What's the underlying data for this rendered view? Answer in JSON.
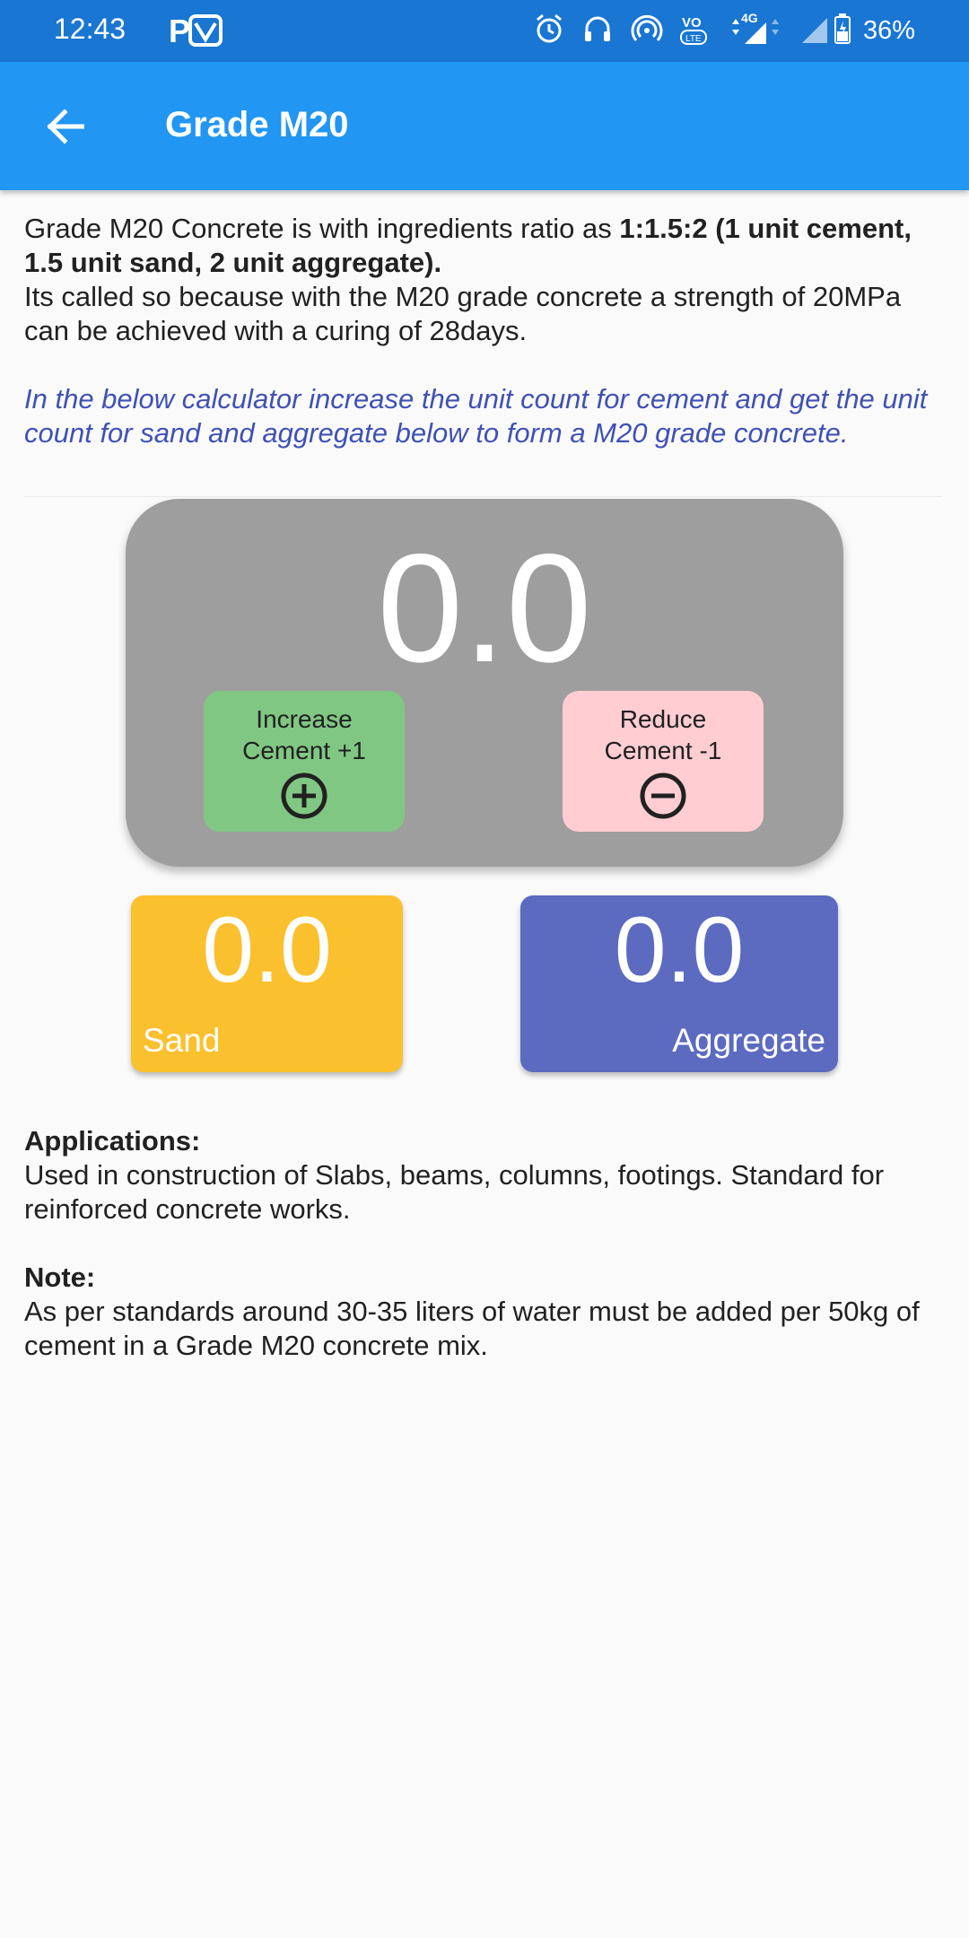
{
  "status_bar": {
    "time": "12:43",
    "network": "4G",
    "volte": "VO LTE",
    "battery": "36%"
  },
  "header": {
    "title": "Grade M20"
  },
  "intro": {
    "text_prefix": "Grade M20 Concrete is with ingredients ratio as ",
    "ratio_bold": "1:1.5:2 (1 unit cement, 1.5 unit sand, 2 unit aggregate).",
    "text_second": "Its called so because with the M20 grade concrete a strength of 20MPa can be achieved with a curing of 28days."
  },
  "calculator_hint": "In the below calculator increase the unit count for cement and get the unit count for sand and aggregate below to form a M20 grade concrete.",
  "calculator": {
    "cement_value": "0.0",
    "increase_label": "Increase Cement +1",
    "reduce_label": "Reduce Cement -1",
    "sand_value": "0.0",
    "sand_label": "Sand",
    "aggregate_value": "0.0",
    "aggregate_label": "Aggregate"
  },
  "applications": {
    "heading": "Applications:",
    "text": "Used in construction of Slabs, beams, columns, footings. Standard for reinforced concrete works."
  },
  "note": {
    "heading": "Note:",
    "text": "As per standards around 30-35 liters of water must be added per 50kg of cement in a Grade M20 concrete mix."
  },
  "colors": {
    "app_bar": "#2196F3",
    "status_bar": "#1976D2",
    "main_card": "#9E9E9E",
    "increase_button": "#81C784",
    "reduce_button": "#FFCDD2",
    "sand_card": "#FBC02D",
    "aggregate_card": "#5C6BC0",
    "hint_text": "#3F51B5"
  },
  "icons": [
    "alarm-icon",
    "headphones-icon",
    "hotspot-icon",
    "volte-icon",
    "signal-icon",
    "battery-icon",
    "back-arrow-icon",
    "plus-circle-icon",
    "minus-circle-icon"
  ]
}
